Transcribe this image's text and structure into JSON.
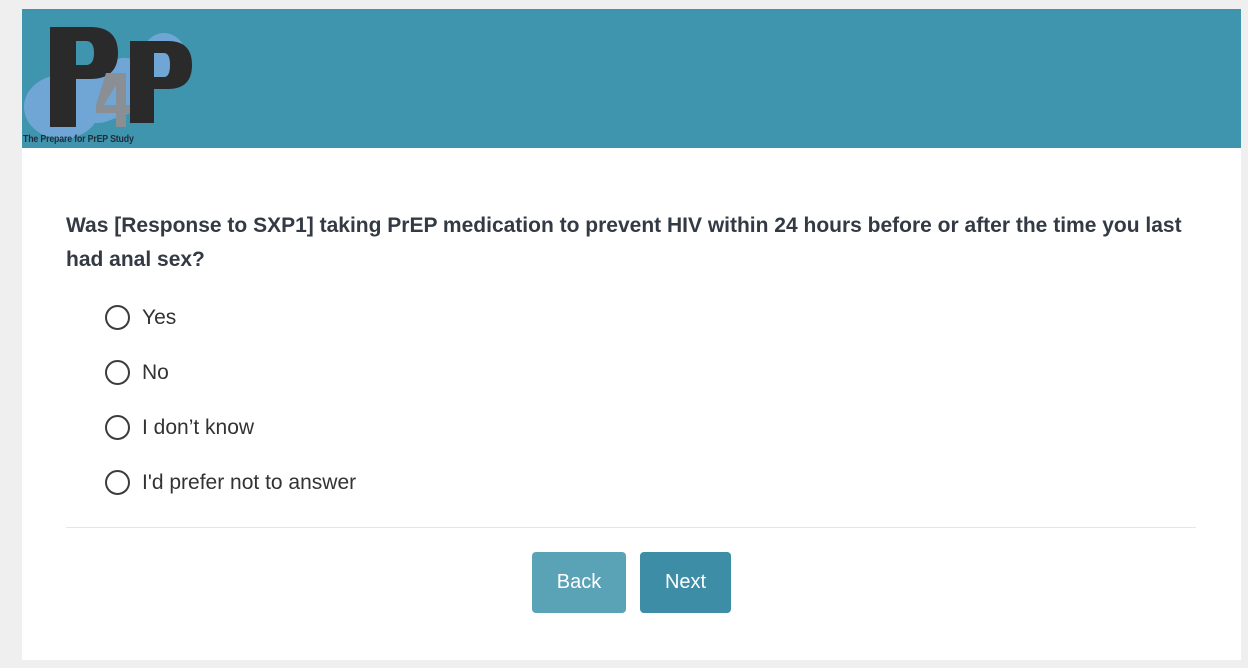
{
  "header": {
    "logo_caption": "The Prepare for PrEP Study",
    "background_color": "#4095ae",
    "logo_colors": {
      "shape": "#6fa6d6",
      "letter_dark": "#2a2a2a",
      "letter_four": "#8a8f95"
    }
  },
  "question": {
    "text": "Was [Response to SXP1] taking PrEP medication to prevent HIV within 24 hours before or after the time you last had anal sex?"
  },
  "options": [
    {
      "label": "Yes",
      "selected": false
    },
    {
      "label": "No",
      "selected": false
    },
    {
      "label": "I don’t know",
      "selected": false
    },
    {
      "label": "I'd prefer not to answer",
      "selected": false
    }
  ],
  "nav": {
    "back_label": "Back",
    "next_label": "Next",
    "back_color": "#5aa2b6",
    "next_color": "#3d8da6"
  }
}
